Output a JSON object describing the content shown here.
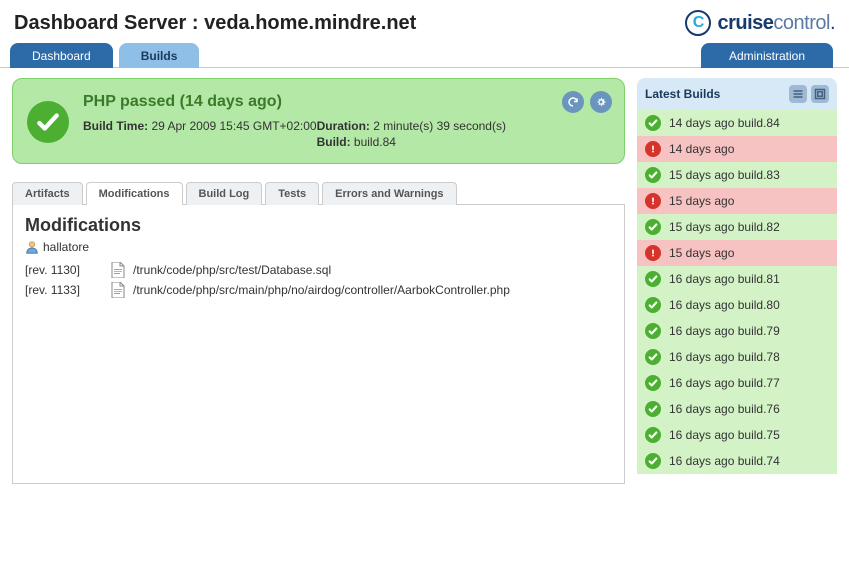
{
  "header": {
    "title": "Dashboard Server : veda.home.mindre.net",
    "logo_cruise": "cruise",
    "logo_control": "control"
  },
  "tabs": {
    "dashboard": "Dashboard",
    "builds": "Builds",
    "admin": "Administration"
  },
  "status": {
    "title": "PHP passed (14 days ago)",
    "build_time_label": "Build Time: ",
    "build_time_value": "29 Apr 2009 15:45 GMT+02:00",
    "duration_label": "Duration: ",
    "duration_value": "2 minute(s) 39 second(s)",
    "build_label": "Build: ",
    "build_value": "build.84"
  },
  "detail_tabs": {
    "artifacts": "Artifacts",
    "modifications": "Modifications",
    "build_log": "Build Log",
    "tests": "Tests",
    "errors": "Errors and Warnings"
  },
  "modifications": {
    "heading": "Modifications",
    "author": "hallatore",
    "rows": [
      {
        "rev": "[rev. 1130]",
        "path": "/trunk/code/php/src/test/Database.sql"
      },
      {
        "rev": "[rev. 1133]",
        "path": "/trunk/code/php/src/main/php/no/airdog/controller/AarbokController.php"
      }
    ]
  },
  "sidebar": {
    "title": "Latest Builds",
    "items": [
      {
        "status": "pass",
        "text": "14 days ago build.84"
      },
      {
        "status": "fail",
        "text": "14 days ago"
      },
      {
        "status": "pass",
        "text": "15 days ago build.83"
      },
      {
        "status": "fail",
        "text": "15 days ago"
      },
      {
        "status": "pass",
        "text": "15 days ago build.82"
      },
      {
        "status": "fail",
        "text": "15 days ago"
      },
      {
        "status": "pass",
        "text": "16 days ago build.81"
      },
      {
        "status": "pass",
        "text": "16 days ago build.80"
      },
      {
        "status": "pass",
        "text": "16 days ago build.79"
      },
      {
        "status": "pass",
        "text": "16 days ago build.78"
      },
      {
        "status": "pass",
        "text": "16 days ago build.77"
      },
      {
        "status": "pass",
        "text": "16 days ago build.76"
      },
      {
        "status": "pass",
        "text": "16 days ago build.75"
      },
      {
        "status": "pass",
        "text": "16 days ago build.74"
      }
    ]
  }
}
